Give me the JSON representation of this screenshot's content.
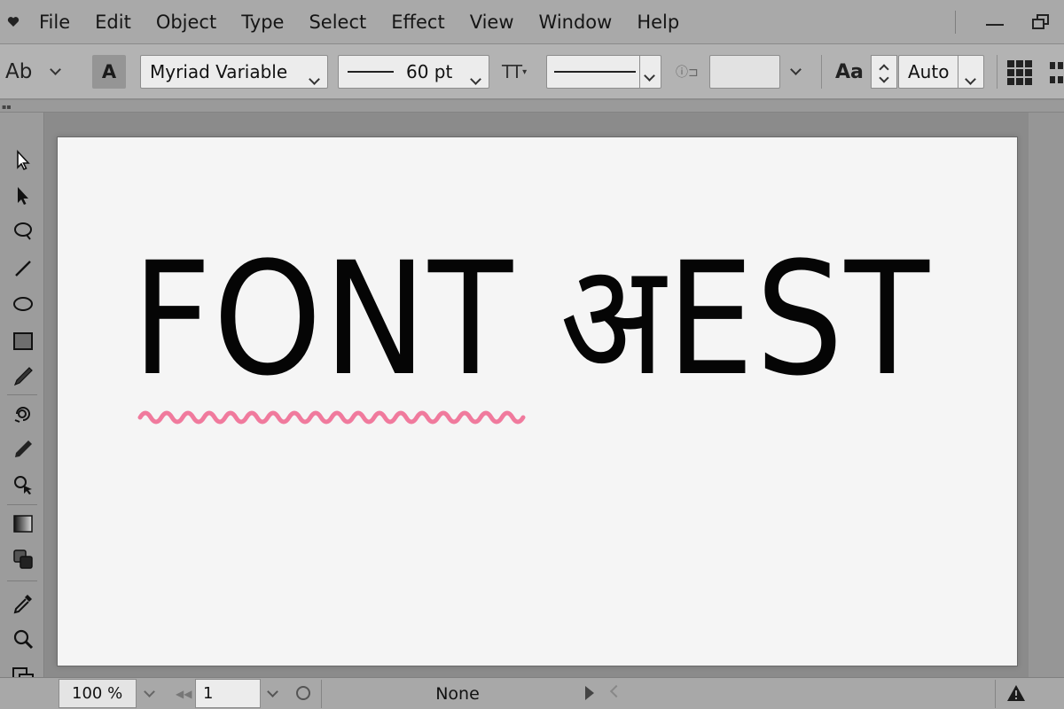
{
  "menubar": {
    "logo_icon": "heart-icon",
    "items": [
      "File",
      "Edit",
      "Object",
      "Type",
      "Select",
      "Effect",
      "View",
      "Window",
      "Help"
    ]
  },
  "controlbar": {
    "character_label": "Ab",
    "font_button_label": "A",
    "font_family": "Myriad Variable",
    "font_size": "60 pt",
    "type_options_label": "TT",
    "leading_icon_label": "Aa",
    "leading": "Auto"
  },
  "canvas": {
    "text": "FONT अEST",
    "squiggle_color": "#f07a9d"
  },
  "statusbar": {
    "zoom": "100 %",
    "artboard_number": "1",
    "status": "None"
  },
  "tools": [
    "selection-tool-icon",
    "direct-selection-tool-icon",
    "lasso-tool-icon",
    "line-tool-icon",
    "ellipse-tool-icon",
    "rectangle-tool-icon",
    "pen-tool-icon",
    "rotate-tool-icon",
    "pencil-tool-icon",
    "shape-builder-tool-icon",
    "gradient-tool-icon",
    "blend-tool-icon",
    "eyedropper-tool-icon",
    "zoom-tool-icon",
    "fill-stroke-icon"
  ]
}
